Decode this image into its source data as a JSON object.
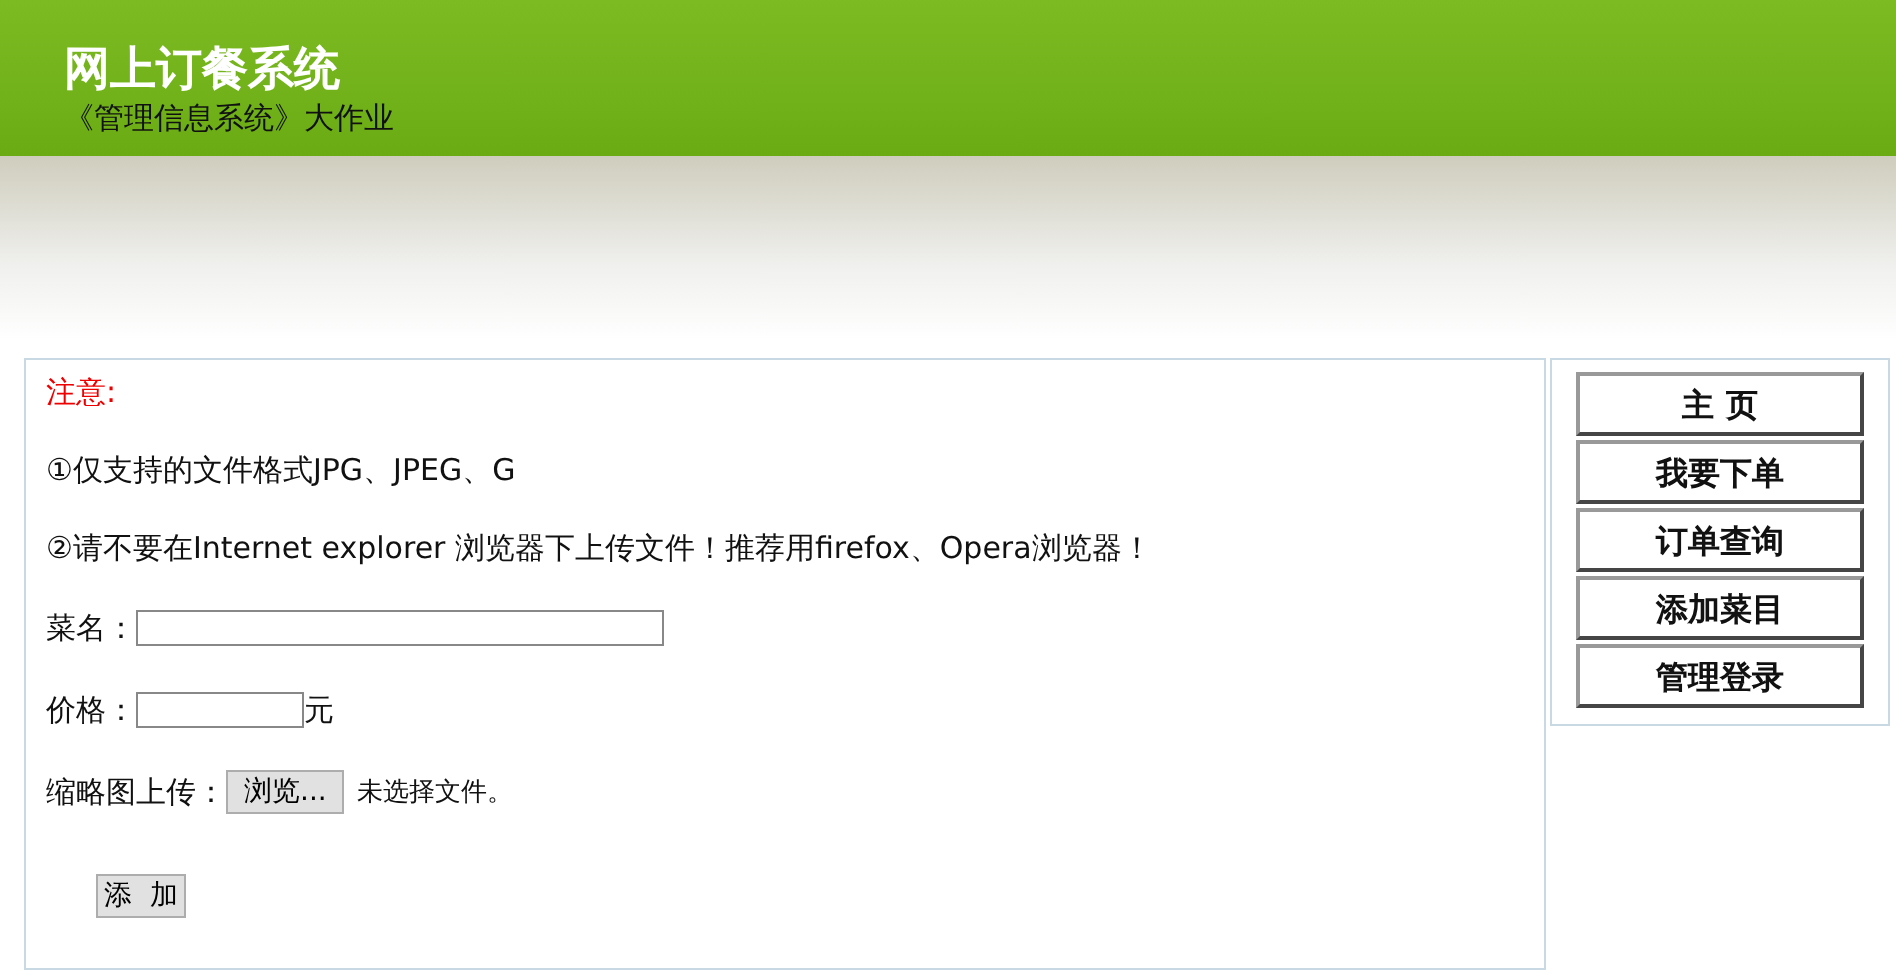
{
  "header": {
    "title": "网上订餐系统",
    "subtitle": "《管理信息系统》大作业"
  },
  "notice": {
    "heading": "注意:",
    "lines": [
      "①仅支持的文件格式JPG、JPEG、G",
      "②请不要在Internet explorer 浏览器下上传文件！推荐用firefox、Opera浏览器！"
    ]
  },
  "form": {
    "name_label": "菜名：",
    "price_label": "价格：",
    "price_unit": "元",
    "thumb_label": "缩略图上传：",
    "browse_button": "浏览...",
    "file_status": "未选择文件。",
    "submit_button": "添  加"
  },
  "nav": {
    "items": [
      {
        "label": "主 页"
      },
      {
        "label": "我要下单"
      },
      {
        "label": "订单查询"
      },
      {
        "label": "添加菜目"
      },
      {
        "label": "管理登录"
      }
    ]
  }
}
